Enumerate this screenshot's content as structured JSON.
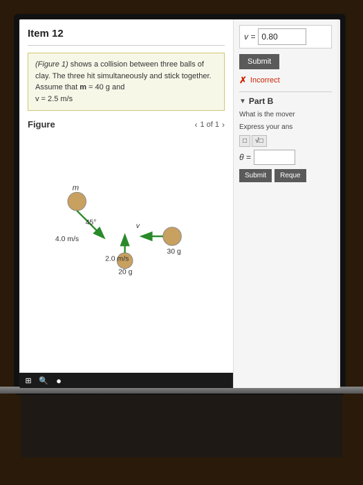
{
  "item": {
    "title": "Item 12"
  },
  "problem": {
    "text_part1": "(Figure 1) shows a collision between three balls of clay. The three hit simultaneously and stick together. Assume that ",
    "bold_m": "m",
    "text_part2": " = 40  g and",
    "text_part3": "v = 2.5  m/s"
  },
  "figure": {
    "label": "Figure",
    "nav_text": "1 of 1",
    "balls": [
      {
        "label": "m",
        "velocity": "4.0 m/s",
        "angle": "45°"
      },
      {
        "label": "30 g",
        "velocity_label": "v"
      },
      {
        "label": "20 g",
        "velocity": "2.0 m/s"
      }
    ]
  },
  "part_a": {
    "answer_label": "v =",
    "answer_value": "0.80",
    "submit_label": "Submit",
    "status": "Incorrect"
  },
  "part_b": {
    "header": "Part B",
    "description_line1": "What is the mover",
    "description_line2": "Express your ans",
    "theta_label": "θ =",
    "math_buttons": [
      "□",
      "√□"
    ],
    "submit_label": "Submit",
    "request_label": "Reque"
  },
  "taskbar": {
    "icons": [
      "⊞",
      "🔍",
      "●"
    ]
  }
}
